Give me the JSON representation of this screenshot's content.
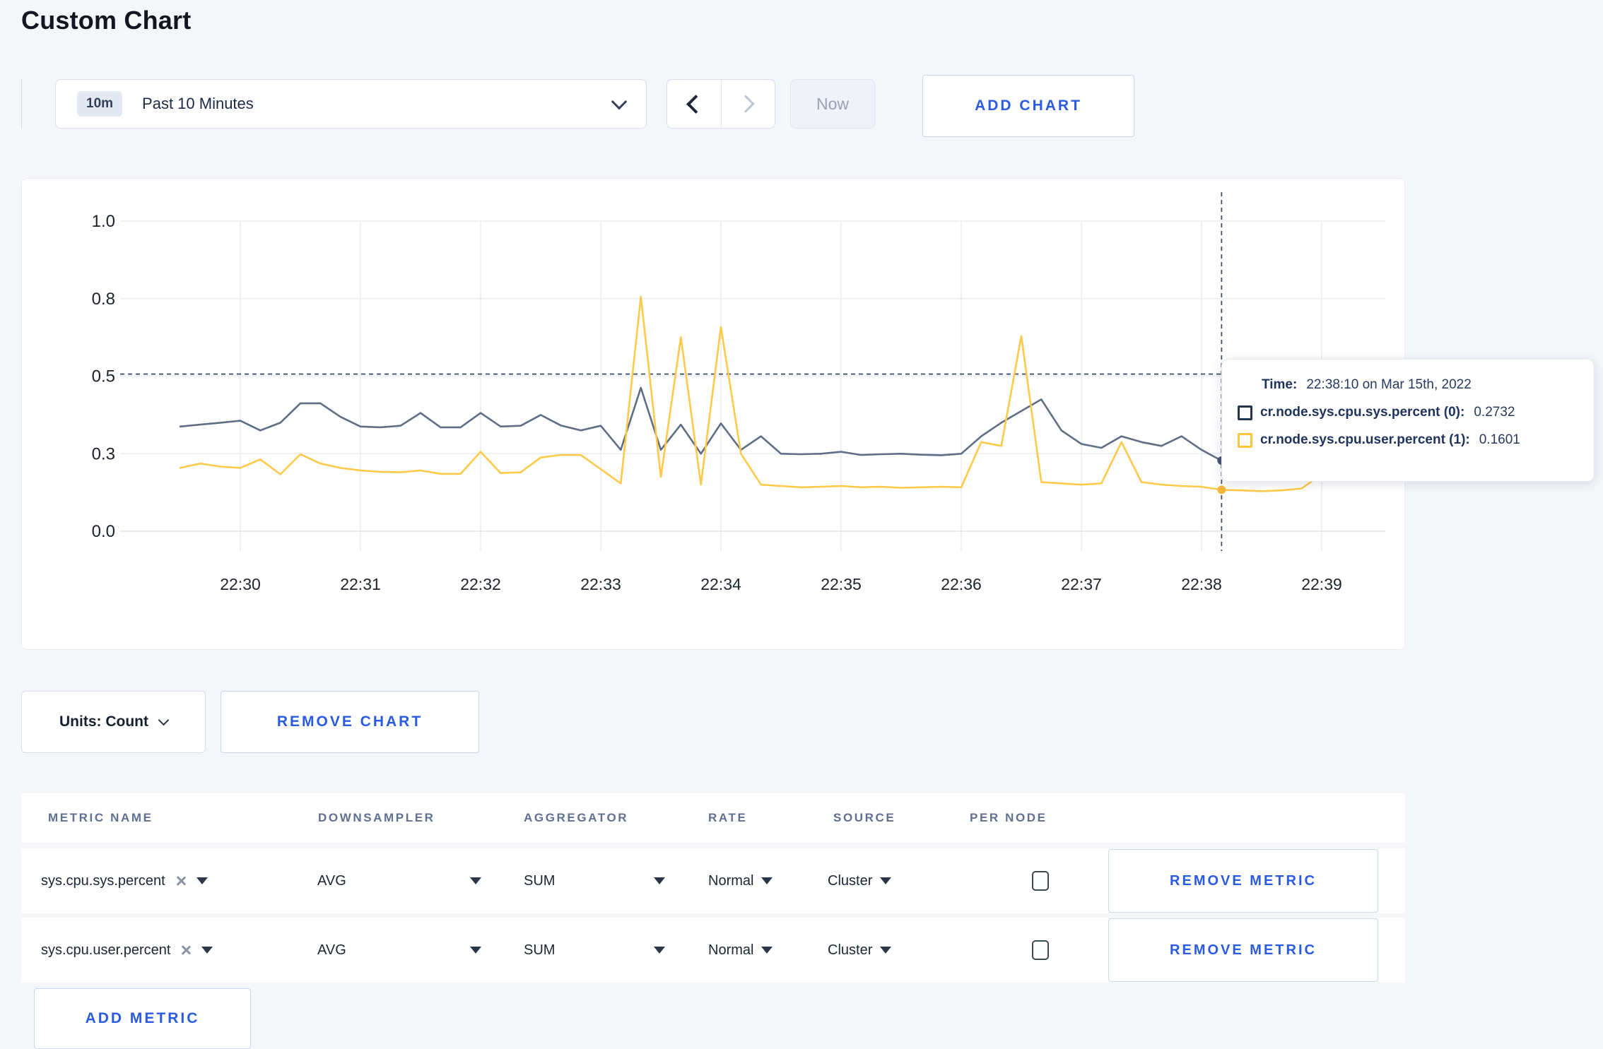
{
  "page": {
    "title": "Custom Chart",
    "background_color": "#f4f6fa",
    "accent_blue": "#2a5be0"
  },
  "toolbar": {
    "time_range": {
      "badge": "10m",
      "label": "Past 10 Minutes"
    },
    "now_label": "Now",
    "add_chart_label": "ADD CHART"
  },
  "chart_data": {
    "type": "line",
    "title": "",
    "start_time": "22:29:30",
    "interval_seconds": 10,
    "x_tick_labels": [
      "22:30",
      "22:31",
      "22:32",
      "22:33",
      "22:34",
      "22:35",
      "22:36",
      "22:37",
      "22:38",
      "22:39"
    ],
    "y_ticks": [
      {
        "v": 0,
        "label": "0.0"
      },
      {
        "v": 0.3,
        "label": "0.3"
      },
      {
        "v": 0.5,
        "label": "0.5"
      },
      {
        "v": 0.8,
        "label": "0.8"
      },
      {
        "v": 1.0,
        "label": "1.0"
      }
    ],
    "grid": true,
    "legend_position": "none",
    "series": [
      {
        "name": "cr.node.sys.cpu.sys.percent",
        "color": "#5f6d85",
        "values": [
          0.37,
          0.375,
          0.38,
          0.385,
          0.36,
          0.38,
          0.43,
          0.43,
          0.395,
          0.37,
          0.368,
          0.372,
          0.405,
          0.368,
          0.368,
          0.405,
          0.37,
          0.372,
          0.4,
          0.373,
          0.36,
          0.372,
          0.31,
          0.47,
          0.31,
          0.375,
          0.3,
          0.378,
          0.31,
          0.345,
          0.3,
          0.298,
          0.3,
          0.305,
          0.295,
          0.298,
          0.3,
          0.296,
          0.294,
          0.3,
          0.345,
          0.38,
          0.41,
          0.44,
          0.36,
          0.325,
          0.315,
          0.345,
          0.33,
          0.32,
          0.345,
          0.31,
          0.2732,
          0.315,
          0.305,
          0.3,
          0.31,
          0.33,
          0.305,
          0.3
        ]
      },
      {
        "name": "cr.node.sys.cpu.user.percent",
        "color": "#ffc949",
        "values": [
          0.245,
          0.262,
          0.25,
          0.245,
          0.278,
          0.22,
          0.298,
          0.262,
          0.245,
          0.235,
          0.23,
          0.228,
          0.235,
          0.222,
          0.222,
          0.305,
          0.225,
          0.228,
          0.285,
          0.295,
          0.295,
          0.24,
          0.185,
          0.805,
          0.21,
          0.65,
          0.18,
          0.69,
          0.3,
          0.18,
          0.175,
          0.17,
          0.172,
          0.175,
          0.17,
          0.172,
          0.168,
          0.17,
          0.172,
          0.17,
          0.33,
          0.32,
          0.655,
          0.19,
          0.185,
          0.18,
          0.185,
          0.33,
          0.19,
          0.18,
          0.175,
          0.172,
          0.1601,
          0.158,
          0.155,
          0.158,
          0.165,
          0.22,
          0.27,
          0.27
        ]
      }
    ],
    "hover": {
      "index": 52,
      "y_value": 0.508,
      "dot_values": [
        0.2732,
        0.1601
      ]
    }
  },
  "tooltip": {
    "time_label": "Time:",
    "time_value": "22:38:10 on Mar 15th, 2022",
    "rows": [
      {
        "label": "cr.node.sys.cpu.sys.percent (0):",
        "value": "0.2732",
        "color": "#26334f"
      },
      {
        "label": "cr.node.sys.cpu.user.percent (1):",
        "value": "0.1601",
        "color": "#ffc53d"
      }
    ]
  },
  "chart_footer": {
    "units_label": "Units: Count",
    "remove_chart_label": "REMOVE CHART"
  },
  "metrics_table": {
    "headers": [
      "METRIC NAME",
      "DOWNSAMPLER",
      "AGGREGATOR",
      "RATE",
      "SOURCE",
      "PER NODE"
    ],
    "rows": [
      {
        "name": "sys.cpu.sys.percent",
        "downsampler": "AVG",
        "aggregator": "SUM",
        "rate": "Normal",
        "source": "Cluster",
        "per_node_checked": false,
        "remove_label": "REMOVE METRIC"
      },
      {
        "name": "sys.cpu.user.percent",
        "downsampler": "AVG",
        "aggregator": "SUM",
        "rate": "Normal",
        "source": "Cluster",
        "per_node_checked": false,
        "remove_label": "REMOVE METRIC"
      }
    ],
    "add_metric_label": "ADD METRIC"
  }
}
